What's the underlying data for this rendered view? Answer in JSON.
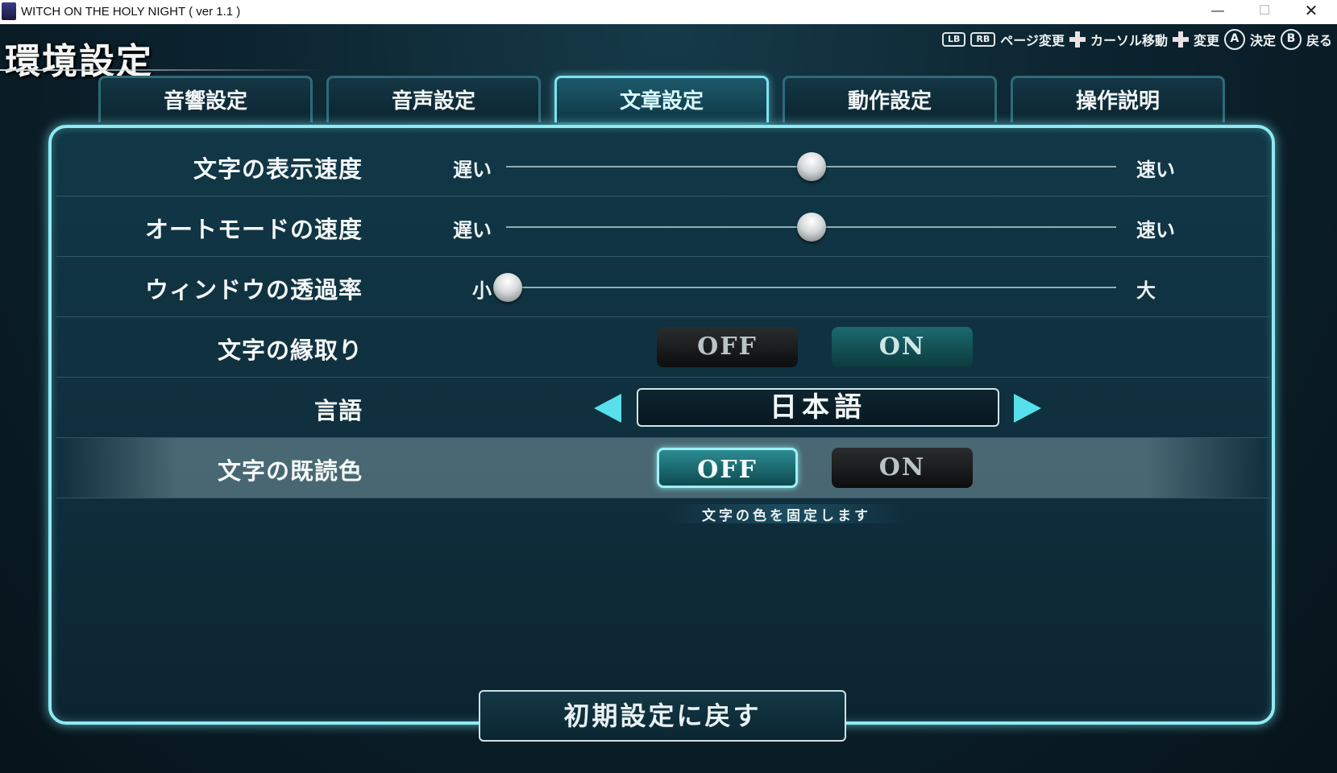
{
  "window": {
    "title": "WITCH ON THE HOLY NIGHT ( ver 1.1 )",
    "minimize": "—",
    "maximize": "☐",
    "close": "✕"
  },
  "screen_title": "環境設定",
  "help": {
    "lb": "LB",
    "rb": "RB",
    "page_change": "ページ変更",
    "cursor_move": "カーソル移動",
    "change": "変更",
    "a": "A",
    "confirm": "決定",
    "b": "B",
    "back": "戻る"
  },
  "tabs": [
    {
      "label": "音響設定"
    },
    {
      "label": "音声設定"
    },
    {
      "label": "文章設定",
      "active": true
    },
    {
      "label": "動作設定"
    },
    {
      "label": "操作説明"
    }
  ],
  "settings": {
    "text_speed": {
      "label": "文字の表示速度",
      "min_label": "遅い",
      "max_label": "速い",
      "value": 0.5
    },
    "auto_speed": {
      "label": "オートモードの速度",
      "min_label": "遅い",
      "max_label": "速い",
      "value": 0.5
    },
    "window_opacity": {
      "label": "ウィンドウの透過率",
      "min_label": "小",
      "max_label": "大",
      "value": 0.0
    },
    "text_outline": {
      "label": "文字の縁取り",
      "off": "OFF",
      "on": "ON",
      "selected": "ON"
    },
    "language": {
      "label": "言語",
      "value": "日本語"
    },
    "read_color": {
      "label": "文字の既読色",
      "off": "OFF",
      "on": "ON",
      "selected": "OFF",
      "hint": "文字の色を固定します"
    }
  },
  "reset_button": "初期設定に戻す",
  "colors": {
    "accent": "#8feaf2",
    "arrow": "#57e0ec"
  }
}
